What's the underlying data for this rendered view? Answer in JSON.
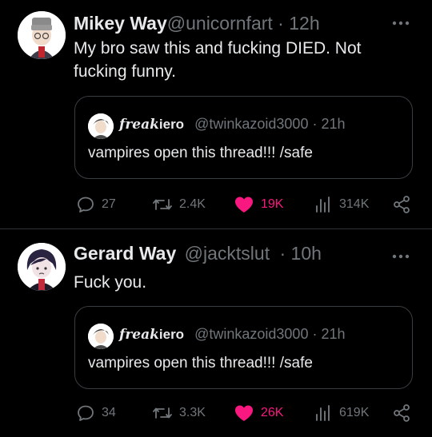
{
  "tweets": [
    {
      "name": "Mikey Way",
      "handle": "@unicornfart",
      "sep": "·",
      "time": "12h",
      "text": "My bro saw this and fucking DIED. Not fucking funny.",
      "quote": {
        "name_script": "freak",
        "name_rest": "iero",
        "handle": "@twinkazoid3000",
        "sep": "·",
        "time": "21h",
        "text": "vampires open this thread!!! /safe"
      },
      "replies": "27",
      "retweets": "2.4K",
      "likes": "19K",
      "views": "314K"
    },
    {
      "name": "Gerard Way",
      "handle": "@jacktslut",
      "sep": "·",
      "time": "10h",
      "text": "Fuck you.",
      "quote": {
        "name_script": "freak",
        "name_rest": "iero",
        "handle": "@twinkazoid3000",
        "sep": "·",
        "time": "21h",
        "text": "vampires open this thread!!! /safe"
      },
      "replies": "34",
      "retweets": "3.3K",
      "likes": "26K",
      "views": "619K"
    }
  ],
  "colors": {
    "background": "#000000",
    "text": "#e7e9ea",
    "muted": "#71767b",
    "like": "#f91880",
    "border": "#2f3336"
  },
  "icons": [
    "more-icon",
    "reply-icon",
    "retweet-icon",
    "heart-icon",
    "views-icon",
    "share-icon"
  ]
}
